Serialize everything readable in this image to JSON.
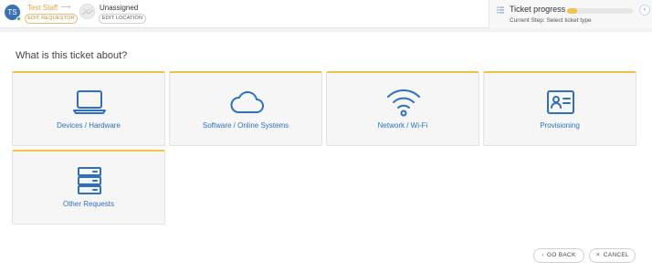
{
  "header": {
    "avatar_initials": "TS",
    "requestor_name": "Test Staff",
    "edit_requestor_label": "EDIT REQUESTOR",
    "assignee": "Unassigned",
    "edit_location_label": "EDIT LOCATION",
    "arrow_icon": "arrow-right-icon"
  },
  "progress": {
    "title": "Ticket progress",
    "current_step": "Current Step: Select ticket type",
    "fill_fraction": 0.15,
    "fill_color": "#f2c24b"
  },
  "main": {
    "question": "What is this ticket about?",
    "categories": [
      {
        "label": "Devices / Hardware",
        "icon": "laptop-icon"
      },
      {
        "label": "Software / Online Systems",
        "icon": "cloud-icon"
      },
      {
        "label": "Network / Wi-Fi",
        "icon": "wifi-icon"
      },
      {
        "label": "Provisioning",
        "icon": "id-card-icon"
      },
      {
        "label": "Other Requests",
        "icon": "server-icon"
      }
    ]
  },
  "footer": {
    "back_label": "GO BACK",
    "cancel_label": "CANCEL"
  },
  "colors": {
    "accent": "#f2c24b",
    "link_blue": "#2e6fbf",
    "avatar_blue": "#3c6fb4",
    "online_green": "#2fb44a"
  }
}
